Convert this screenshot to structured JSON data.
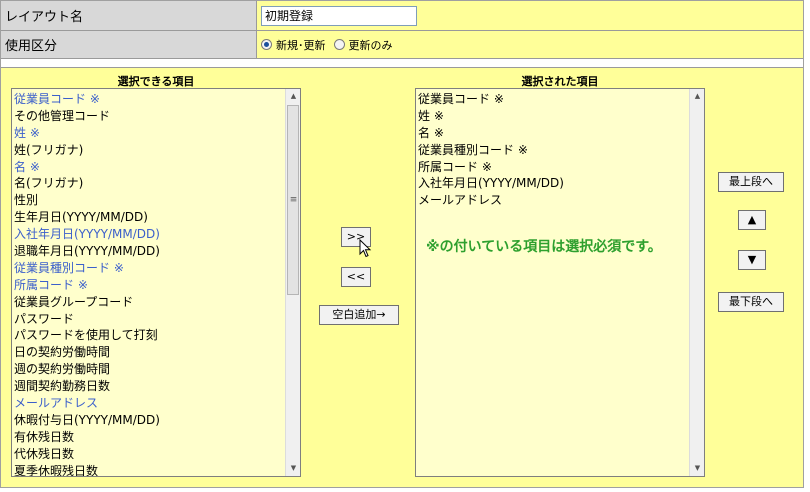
{
  "layout_name": {
    "label": "レイアウト名",
    "value": "初期登録"
  },
  "usage": {
    "label": "使用区分",
    "options": [
      {
        "label": "新規･更新",
        "selected": true
      },
      {
        "label": "更新のみ",
        "selected": false
      }
    ]
  },
  "available": {
    "header": "選択できる項目",
    "items": [
      {
        "label": "従業員コード ※",
        "required": true
      },
      {
        "label": "その他管理コード",
        "required": false
      },
      {
        "label": "姓 ※",
        "required": true
      },
      {
        "label": "姓(フリガナ)",
        "required": false
      },
      {
        "label": "名 ※",
        "required": true
      },
      {
        "label": "名(フリガナ)",
        "required": false
      },
      {
        "label": "性別",
        "required": false
      },
      {
        "label": "生年月日(YYYY/MM/DD)",
        "required": false
      },
      {
        "label": "入社年月日(YYYY/MM/DD)",
        "required": true
      },
      {
        "label": "退職年月日(YYYY/MM/DD)",
        "required": false
      },
      {
        "label": "従業員種別コード ※",
        "required": true
      },
      {
        "label": "所属コード ※",
        "required": true
      },
      {
        "label": "従業員グループコード",
        "required": false
      },
      {
        "label": "パスワード",
        "required": false
      },
      {
        "label": "パスワードを使用して打刻",
        "required": false
      },
      {
        "label": "日の契約労働時間",
        "required": false
      },
      {
        "label": "週の契約労働時間",
        "required": false
      },
      {
        "label": "週間契約勤務日数",
        "required": false
      },
      {
        "label": "メールアドレス",
        "required": true
      },
      {
        "label": "休暇付与日(YYYY/MM/DD)",
        "required": false
      },
      {
        "label": "有休残日数",
        "required": false
      },
      {
        "label": "代休残日数",
        "required": false
      },
      {
        "label": "夏季休暇残日数",
        "required": false
      }
    ]
  },
  "selected": {
    "header": "選択された項目",
    "items": [
      "従業員コード ※",
      "姓 ※",
      "名 ※",
      "従業員種別コード ※",
      "所属コード ※",
      "入社年月日(YYYY/MM/DD)",
      "メールアドレス"
    ]
  },
  "buttons": {
    "add": ">>",
    "remove": "<<",
    "add_blank": "空白追加→",
    "move_top": "最上段へ",
    "move_up": "▲",
    "move_down": "▼",
    "move_bottom": "最下段へ"
  },
  "note": "※の付いている項目は選択必須です。",
  "colors": {
    "panel_bg": "#ffff99",
    "list_bg": "#ffffcc",
    "label_bg": "#d8d8d8",
    "required_text": "#3b5fcb",
    "note_text": "#2ea02e"
  }
}
